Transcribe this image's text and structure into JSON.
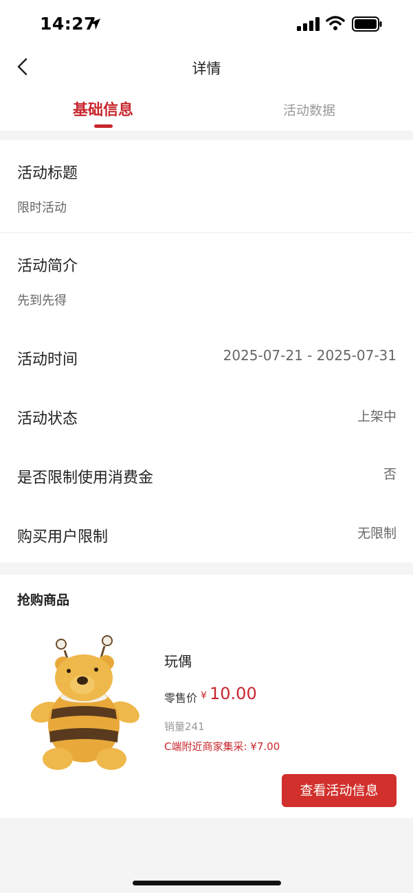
{
  "status_bar": {
    "time": "14:27"
  },
  "nav": {
    "title": "详情"
  },
  "tabs": [
    {
      "label": "基础信息",
      "active": true
    },
    {
      "label": "活动数据",
      "active": false
    }
  ],
  "info": {
    "title_label": "活动标题",
    "title_value": "限时活动",
    "intro_label": "活动简介",
    "intro_value": "先到先得",
    "rows": [
      {
        "label": "活动时间",
        "value": "2025-07-21 - 2025-07-31"
      },
      {
        "label": "活动状态",
        "value": "上架中"
      },
      {
        "label": "是否限制使用消费金",
        "value": "否"
      },
      {
        "label": "购买用户限制",
        "value": "无限制"
      }
    ]
  },
  "products": {
    "section_title": "抢购商品",
    "items": [
      {
        "name": "玩偶",
        "price_label": "零售价",
        "currency": "¥",
        "price": "10.00",
        "sales": "销量241",
        "c_price": "C端附近商家集采: ¥7.00",
        "image_icon": "bee-plush-toy-icon"
      }
    ],
    "view_button": "查看活动信息"
  },
  "colors": {
    "accent": "#c8262d",
    "button": "#d1302c",
    "muted_text": "#999999",
    "background": "#f4f4f4"
  }
}
